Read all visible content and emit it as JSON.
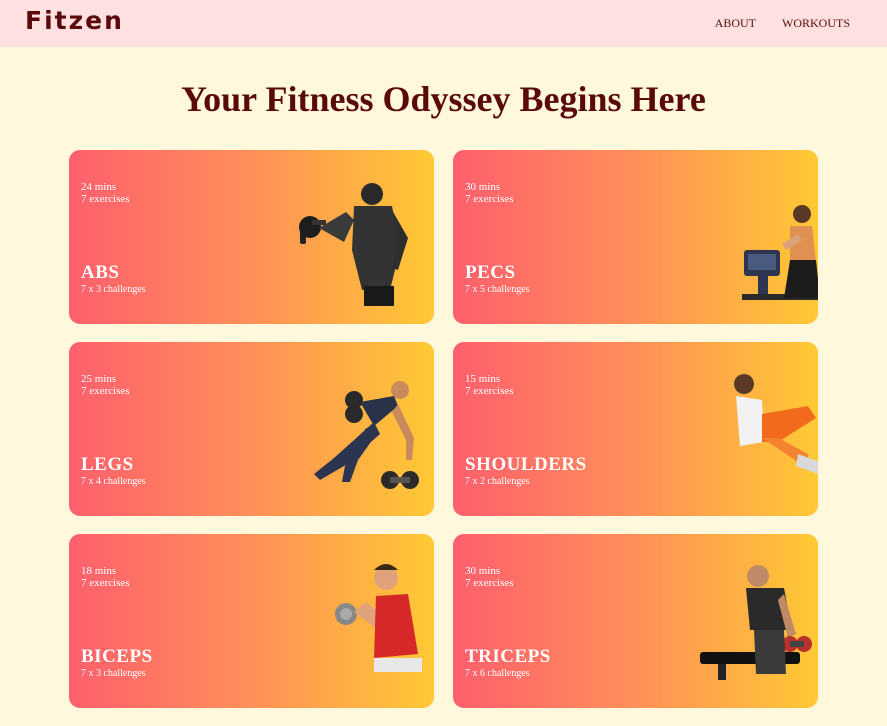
{
  "nav": {
    "brand": "Fitzen",
    "links": [
      "ABOUT",
      "WORKOUTS"
    ]
  },
  "headline": "Your Fitness Odyssey Begins Here",
  "colors": {
    "nav_bg": "#ffe0e0",
    "page_bg": "#fff8dc",
    "text_dark": "#5a0a0a",
    "gradient_start": "#fe5f6d",
    "gradient_end": "#ffc934"
  },
  "cards": [
    {
      "duration": "24 mins",
      "exercises": "7 exercises",
      "title": "ABS",
      "challenges": "7 x 3 challenges",
      "image": "man-dumbbell-curl-photo"
    },
    {
      "duration": "30 mins",
      "exercises": "7 exercises",
      "title": "PECS",
      "challenges": "7 x 5 challenges",
      "image": "woman-rowing-machine-photo"
    },
    {
      "duration": "25 mins",
      "exercises": "7 exercises",
      "title": "LEGS",
      "challenges": "7 x 4 challenges",
      "image": "woman-lunge-dumbbells-photo"
    },
    {
      "duration": "15 mins",
      "exercises": "7 exercises",
      "title": "SHOULDERS",
      "challenges": "7 x 2 challenges",
      "image": "woman-crunch-photo"
    },
    {
      "duration": "18 mins",
      "exercises": "7 exercises",
      "title": "BICEPS",
      "challenges": "7 x 3 challenges",
      "image": "man-red-tank-curl-photo"
    },
    {
      "duration": "30 mins",
      "exercises": "7 exercises",
      "title": "TRICEPS",
      "challenges": "7 x 6 challenges",
      "image": "man-bench-row-photo"
    }
  ]
}
